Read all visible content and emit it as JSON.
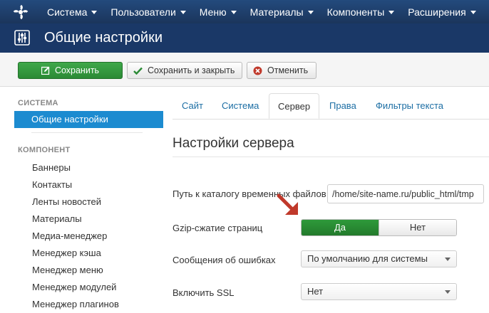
{
  "topnav": {
    "items": [
      {
        "label": "Система"
      },
      {
        "label": "Пользователи"
      },
      {
        "label": "Меню"
      },
      {
        "label": "Материалы"
      },
      {
        "label": "Компоненты"
      },
      {
        "label": "Расширения"
      }
    ]
  },
  "header": {
    "title": "Общие настройки"
  },
  "toolbar": {
    "save_label": "Сохранить",
    "save_close_label": "Сохранить и закрыть",
    "cancel_label": "Отменить"
  },
  "sidebar": {
    "system_heading": "СИСТЕМА",
    "active_item": "Общие настройки",
    "component_heading": "КОМПОНЕНТ",
    "items": [
      {
        "label": "Баннеры"
      },
      {
        "label": "Контакты"
      },
      {
        "label": "Ленты новостей"
      },
      {
        "label": "Материалы"
      },
      {
        "label": "Медиа-менеджер"
      },
      {
        "label": "Менеджер кэша"
      },
      {
        "label": "Менеджер меню"
      },
      {
        "label": "Менеджер модулей"
      },
      {
        "label": "Менеджер плагинов"
      }
    ]
  },
  "tabs": [
    {
      "label": "Сайт"
    },
    {
      "label": "Система"
    },
    {
      "label": "Сервер"
    },
    {
      "label": "Права"
    },
    {
      "label": "Фильтры текста"
    }
  ],
  "main": {
    "section_title": "Настройки сервера",
    "temp_path_label": "Путь к каталогу временных файлов",
    "temp_path_value": "/home/site-name.ru/public_html/tmp",
    "gzip_label": "Gzip-сжатие страниц",
    "gzip_yes": "Да",
    "gzip_no": "Нет",
    "gzip_value": "Да",
    "errors_label": "Сообщения об ошибках",
    "errors_value": "По умолчанию для системы",
    "ssl_label": "Включить SSL",
    "ssl_value": "Нет"
  },
  "colors": {
    "nav": "#1b355c",
    "header": "#1a3867",
    "accent": "#1c8bd0",
    "save_green": "#2b8a35",
    "arrow_red": "#c0392b"
  }
}
